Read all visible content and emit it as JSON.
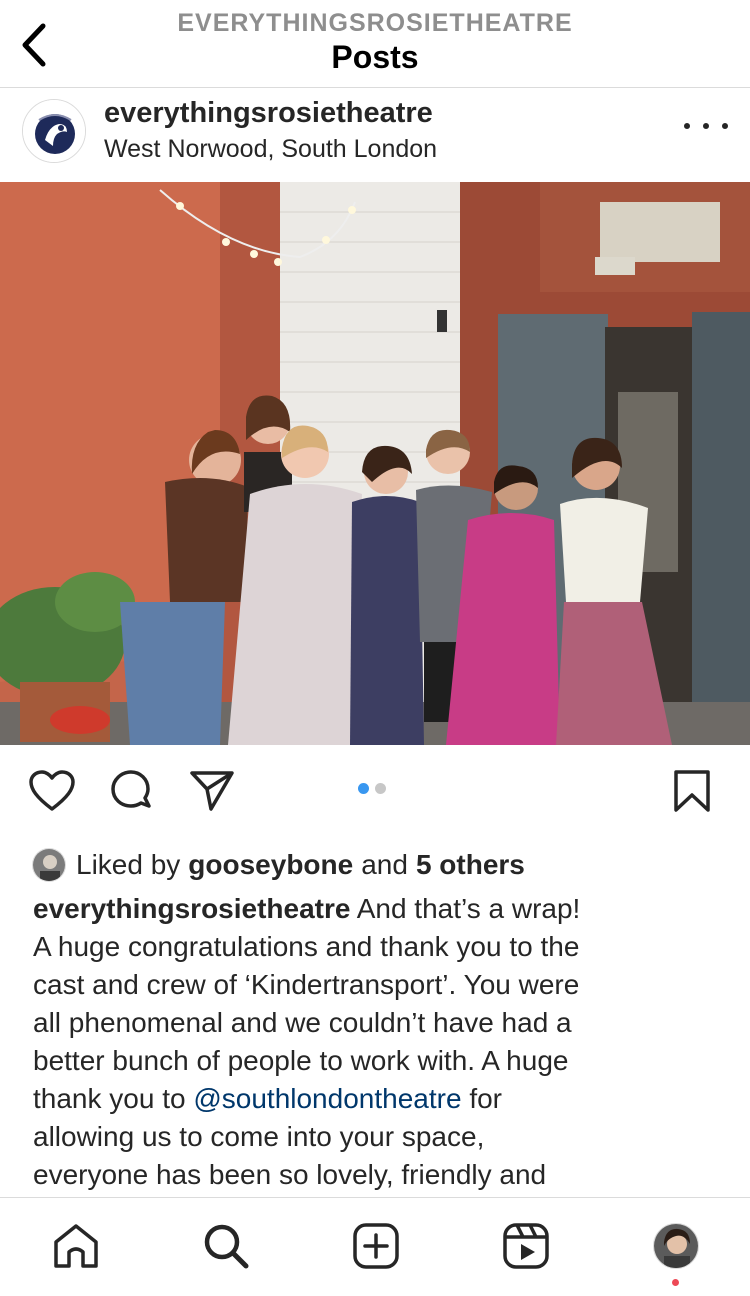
{
  "header": {
    "account_name": "EVERYTHINGSROSIETHEATRE",
    "title": "Posts"
  },
  "post": {
    "username": "everythingsrosietheatre",
    "location": "West Norwood, South London",
    "carousel": {
      "count": 2,
      "active_index": 0
    },
    "likes": {
      "prefix": "Liked by",
      "liker": "gooseybone",
      "and": "and",
      "others": "5 others"
    },
    "caption": {
      "author": "everythingsrosietheatre",
      "line1": "And that’s a wrap!",
      "line2": "A huge congratulations and thank you to the",
      "line3": "cast and crew of ‘Kindertransport’. You were",
      "line4": "all phenomenal and we couldn’t have had a",
      "line5": "better bunch of people to work with. A huge",
      "line6_before": "thank you to",
      "mention": "@southlondontheatre",
      "line6_after": "for",
      "line7": "allowing us to come into your space,",
      "line8": "everyone has been so lovely, friendly and"
    }
  },
  "icons": {
    "back": "chevron-left-icon",
    "more": "more-horizontal-icon",
    "like": "heart-icon",
    "comment": "comment-icon",
    "share": "send-icon",
    "save": "bookmark-icon",
    "home": "home-icon",
    "search": "search-icon",
    "create": "plus-square-icon",
    "reels": "reels-icon"
  },
  "colors": {
    "text": "#262626",
    "secondary": "#8e8e8e",
    "link": "#00376b",
    "active_dot": "#3897f0",
    "notification": "#ed4956"
  }
}
